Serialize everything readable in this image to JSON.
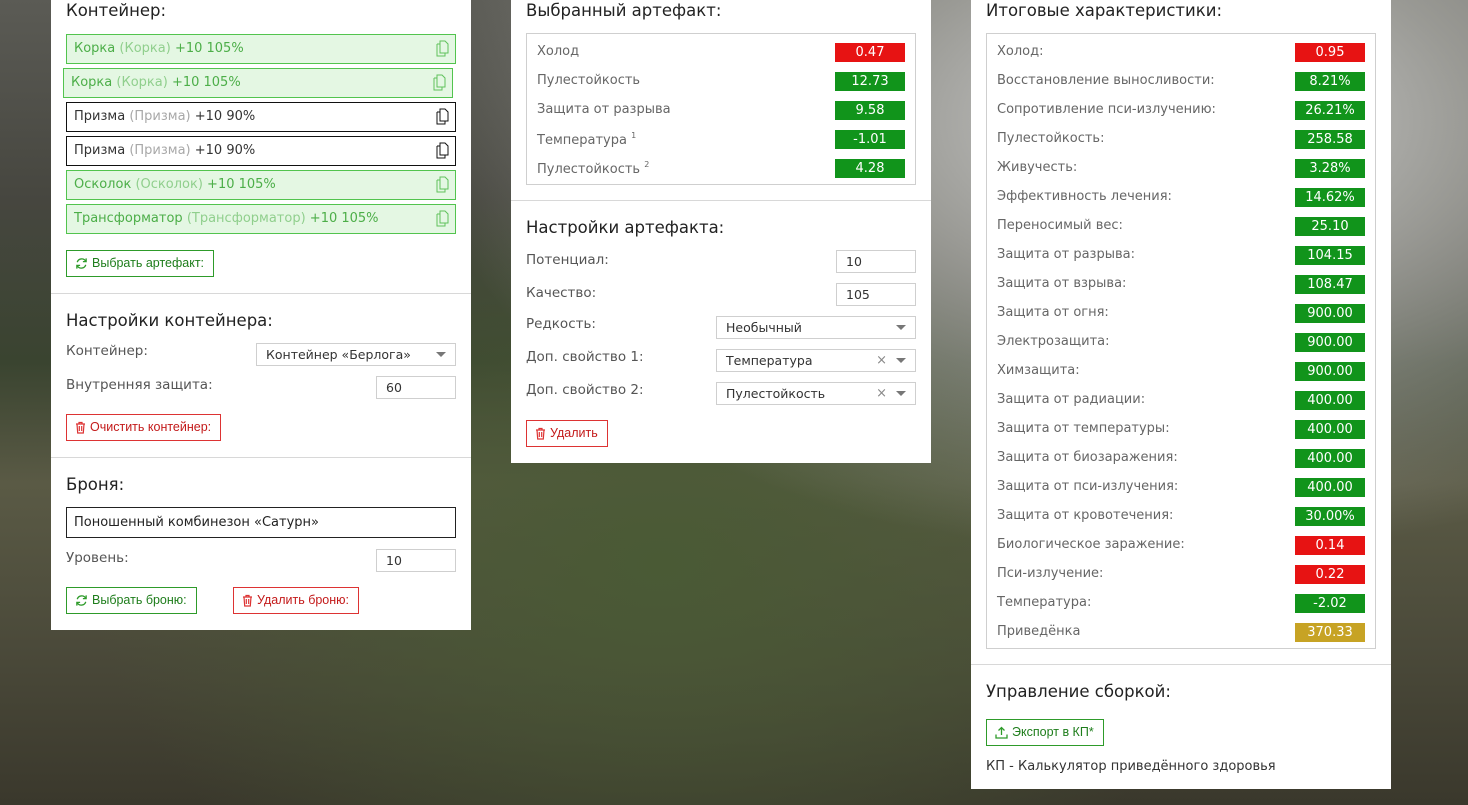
{
  "container_panel": {
    "title": "Контейнер:",
    "slots": [
      {
        "name": "Корка",
        "sub": "(Корка)",
        "level": "+10 105%",
        "active": true
      },
      {
        "name": "Корка",
        "sub": "(Корка)",
        "level": "+10 105%",
        "active": true
      },
      {
        "name": "Призма",
        "sub": "(Призма)",
        "level": "+10 90%",
        "active": false
      },
      {
        "name": "Призма",
        "sub": "(Призма)",
        "level": "+10 90%",
        "active": false
      },
      {
        "name": "Осколок",
        "sub": "(Осколок)",
        "level": "+10 105%",
        "active": true
      },
      {
        "name": "Трансформатор",
        "sub": "(Трансформатор)",
        "level": "+10 105%",
        "active": true
      }
    ],
    "select_artifact_button": "Выбрать артефакт:",
    "settings_title": "Настройки контейнера:",
    "container_label": "Контейнер:",
    "container_value": "Контейнер «Берлога»",
    "internal_protection_label": "Внутренняя защита:",
    "internal_protection_value": "60",
    "clear_button": "Очистить контейнер:",
    "armor_title": "Броня:",
    "armor_value": "Поношенный комбинезон «Сатурн»",
    "level_label": "Уровень:",
    "level_value": "10",
    "select_armor_button": "Выбрать броню:",
    "remove_armor_button": "Удалить броню:"
  },
  "artifact_panel": {
    "title": "Выбранный артефакт:",
    "stats": [
      {
        "name": "Холод",
        "sup": "",
        "value": "0.47",
        "color": "red"
      },
      {
        "name": "Пулестойкость",
        "sup": "",
        "value": "12.73",
        "color": "green"
      },
      {
        "name": "Защита от разрыва",
        "sup": "",
        "value": "9.58",
        "color": "green"
      },
      {
        "name": "Температура",
        "sup": "1",
        "value": "-1.01",
        "color": "green"
      },
      {
        "name": "Пулестойкость",
        "sup": "2",
        "value": "4.28",
        "color": "green"
      }
    ],
    "settings_title": "Настройки артефакта:",
    "potential_label": "Потенциал:",
    "potential_value": "10",
    "quality_label": "Качество:",
    "quality_value": "105",
    "rarity_label": "Редкость:",
    "rarity_value": "Необычный",
    "extra1_label": "Доп. свойство 1:",
    "extra1_value": "Температура",
    "extra2_label": "Доп. свойство 2:",
    "extra2_value": "Пулестойкость",
    "clear_glyph": "×",
    "delete_button": "Удалить"
  },
  "totals_panel": {
    "title": "Итоговые характеристики:",
    "stats": [
      {
        "name": "Холод:",
        "value": "0.95",
        "color": "red"
      },
      {
        "name": "Восстановление выносливости:",
        "value": "8.21%",
        "color": "green"
      },
      {
        "name": "Сопротивление пси-излучению:",
        "value": "26.21%",
        "color": "green"
      },
      {
        "name": "Пулестойкость:",
        "value": "258.58",
        "color": "green"
      },
      {
        "name": "Живучесть:",
        "value": "3.28%",
        "color": "green"
      },
      {
        "name": "Эффективность лечения:",
        "value": "14.62%",
        "color": "green"
      },
      {
        "name": "Переносимый вес:",
        "value": "25.10",
        "color": "green"
      },
      {
        "name": "Защита от разрыва:",
        "value": "104.15",
        "color": "green"
      },
      {
        "name": "Защита от взрыва:",
        "value": "108.47",
        "color": "green"
      },
      {
        "name": "Защита от огня:",
        "value": "900.00",
        "color": "green"
      },
      {
        "name": "Электрозащита:",
        "value": "900.00",
        "color": "green"
      },
      {
        "name": "Химзащита:",
        "value": "900.00",
        "color": "green"
      },
      {
        "name": "Защита от радиации:",
        "value": "400.00",
        "color": "green"
      },
      {
        "name": "Защита от температуры:",
        "value": "400.00",
        "color": "green"
      },
      {
        "name": "Защита от биозаражения:",
        "value": "400.00",
        "color": "green"
      },
      {
        "name": "Защита от пси-излучения:",
        "value": "400.00",
        "color": "green"
      },
      {
        "name": "Защита от кровотечения:",
        "value": "30.00%",
        "color": "green"
      },
      {
        "name": "Биологическое заражение:",
        "value": "0.14",
        "color": "red"
      },
      {
        "name": "Пси-излучение:",
        "value": "0.22",
        "color": "red"
      },
      {
        "name": "Температура:",
        "value": "-2.02",
        "color": "green"
      },
      {
        "name": "Приведёнка",
        "value": "370.33",
        "color": "gold"
      }
    ],
    "build_title": "Управление сборкой:",
    "export_button": "Экспорт в КП*",
    "footnote": "КП - Калькулятор приведённого здоровья"
  },
  "colors": {
    "green": "#11941b",
    "red": "#e71313",
    "gold": "#c7a324",
    "accent_green": "#2e9b2a",
    "accent_red": "#d33333"
  }
}
